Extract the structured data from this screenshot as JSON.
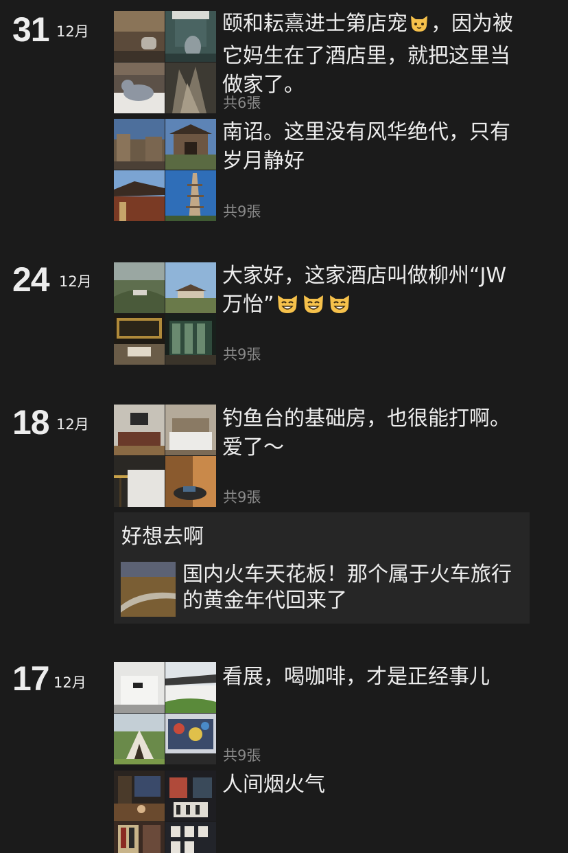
{
  "posts": [
    {
      "day": "31",
      "month": "12月",
      "text_before_emoji": "颐和耘熹进士第店宠",
      "emoji": "cat-face-emoji",
      "text_after_emoji": "，因为被它妈生在了酒店里，就把这里当做家了。",
      "photo_count": "共6張"
    },
    {
      "text": "南诏。这里没有风华绝代，只有岁月静好",
      "photo_count": "共9張"
    },
    {
      "day": "24",
      "month": "12月",
      "text": "大家好，这家酒店叫做柳州“JW万怡”",
      "emoji": "grinning-cat-emoji",
      "photo_count": "共9張"
    },
    {
      "day": "18",
      "month": "12月",
      "text": "钓鱼台的基础房，也很能打啊。爱了～",
      "photo_count": "共9張"
    },
    {
      "day": "17",
      "month": "12月",
      "text": "看展，喝咖啡，才是正经事儿",
      "photo_count": "共9張"
    },
    {
      "text": "人间烟火气"
    }
  ],
  "shared_link": {
    "comment": "好想去啊",
    "title": "国内火车天花板！那个属于火车旅行的黄金年代回来了"
  }
}
